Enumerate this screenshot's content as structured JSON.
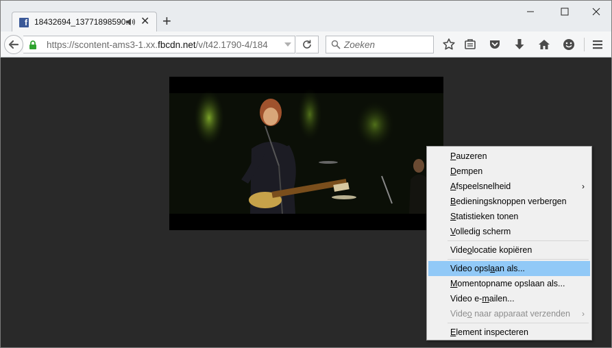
{
  "tab": {
    "title": "18432694_13771898590...",
    "favicon": "f"
  },
  "nav": {
    "url_prefix": "https://scontent-ams3-1.xx.",
    "url_domain": "fbcdn.net",
    "url_suffix": "/v/t42.1790-4/184",
    "search_placeholder": "Zoeken"
  },
  "icons": {
    "tab": [
      "facebook-favicon",
      "speaker-icon",
      "close-icon",
      "plus-icon"
    ],
    "window": [
      "minimize-icon",
      "maximize-icon",
      "close-icon"
    ],
    "toolbar": [
      "back-arrow-icon",
      "lock-icon",
      "dropdown-arrow-icon",
      "reload-icon",
      "search-icon",
      "star-icon",
      "reading-list-icon",
      "pocket-icon",
      "download-icon",
      "home-icon",
      "smiley-icon",
      "hamburger-menu-icon"
    ]
  },
  "context_menu": {
    "groups": [
      [
        {
          "label": "Pauzeren",
          "key": "P"
        },
        {
          "label": "Dempen",
          "key": "D"
        },
        {
          "label": "Afspeelsnelheid",
          "key": "A",
          "submenu": true
        },
        {
          "label": "Bedieningsknoppen verbergen",
          "key": "B"
        },
        {
          "label": "Statistieken tonen",
          "key": "S"
        },
        {
          "label": "Volledig scherm",
          "key": "V"
        }
      ],
      [
        {
          "label": "Videolocatie kopiëren",
          "key": "o"
        }
      ],
      [
        {
          "label": "Video opslaan als...",
          "key": "a",
          "highlighted": true
        },
        {
          "label": "Momentopname opslaan als...",
          "key": "M"
        },
        {
          "label": "Video e-mailen...",
          "key": "m"
        },
        {
          "label": "Video naar apparaat verzenden",
          "key": "o",
          "disabled": true,
          "submenu": true
        }
      ],
      [
        {
          "label": "Element inspecteren",
          "key": "E"
        }
      ]
    ],
    "submenu_arrow": "›"
  },
  "colors": {
    "facebook_blue": "#3b5998",
    "menu_highlight": "#91c9f7",
    "content_bg": "#292929",
    "lock_green": "#2fa32f"
  }
}
